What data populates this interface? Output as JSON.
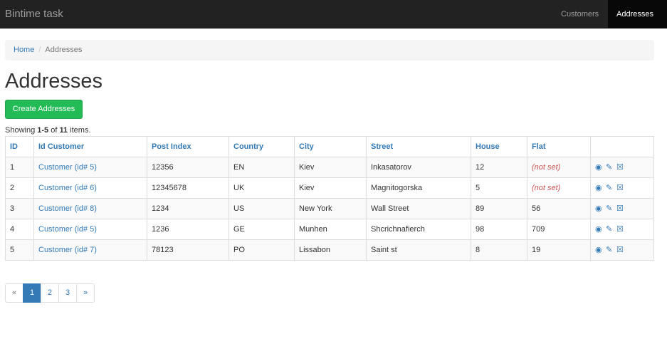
{
  "navbar": {
    "brand": "Bintime task",
    "items": [
      {
        "label": "Customers"
      },
      {
        "label": "Addresses"
      }
    ]
  },
  "breadcrumb": {
    "home": "Home",
    "separator": "/",
    "current": "Addresses"
  },
  "page": {
    "title": "Addresses",
    "create_label": "Create Addresses"
  },
  "summary": {
    "prefix": "Showing ",
    "range": "1-5",
    "middle": " of ",
    "total": "11",
    "suffix": " items."
  },
  "table": {
    "headers": [
      "ID",
      "Id Customer",
      "Post Index",
      "Country",
      "City",
      "Street",
      "House",
      "Flat"
    ],
    "rows": [
      {
        "id": "1",
        "customer": "Customer (id# 5)",
        "post": "12356",
        "country": "EN",
        "city": "Kiev",
        "street": "Inkasatorov",
        "house": "12",
        "flat": "(not set)"
      },
      {
        "id": "2",
        "customer": "Customer (id# 6)",
        "post": "12345678",
        "country": "UK",
        "city": "Kiev",
        "street": "Magnitogorska",
        "house": "5",
        "flat": "(not set)"
      },
      {
        "id": "3",
        "customer": "Customer (id# 8)",
        "post": "1234",
        "country": "US",
        "city": "New York",
        "street": "Wall Street",
        "house": "89",
        "flat": "56"
      },
      {
        "id": "4",
        "customer": "Customer (id# 5)",
        "post": "1236",
        "country": "GE",
        "city": "Munhen",
        "street": "Shcrichnafierch",
        "house": "98",
        "flat": "709"
      },
      {
        "id": "5",
        "customer": "Customer (id# 7)",
        "post": "78123",
        "country": "PO",
        "city": "Lissabon",
        "street": "Saint st",
        "house": "8",
        "flat": "19"
      }
    ],
    "action_icons": [
      "eye-icon",
      "pencil-icon",
      "trash-icon"
    ]
  },
  "pagination": {
    "prev": "«",
    "pages": [
      "1",
      "2",
      "3"
    ],
    "next": "»",
    "active": "1"
  },
  "colors": {
    "navbar": "#222222",
    "link": "#337ab7",
    "create_button": "#22bb55",
    "not_set": "#cc5555"
  }
}
